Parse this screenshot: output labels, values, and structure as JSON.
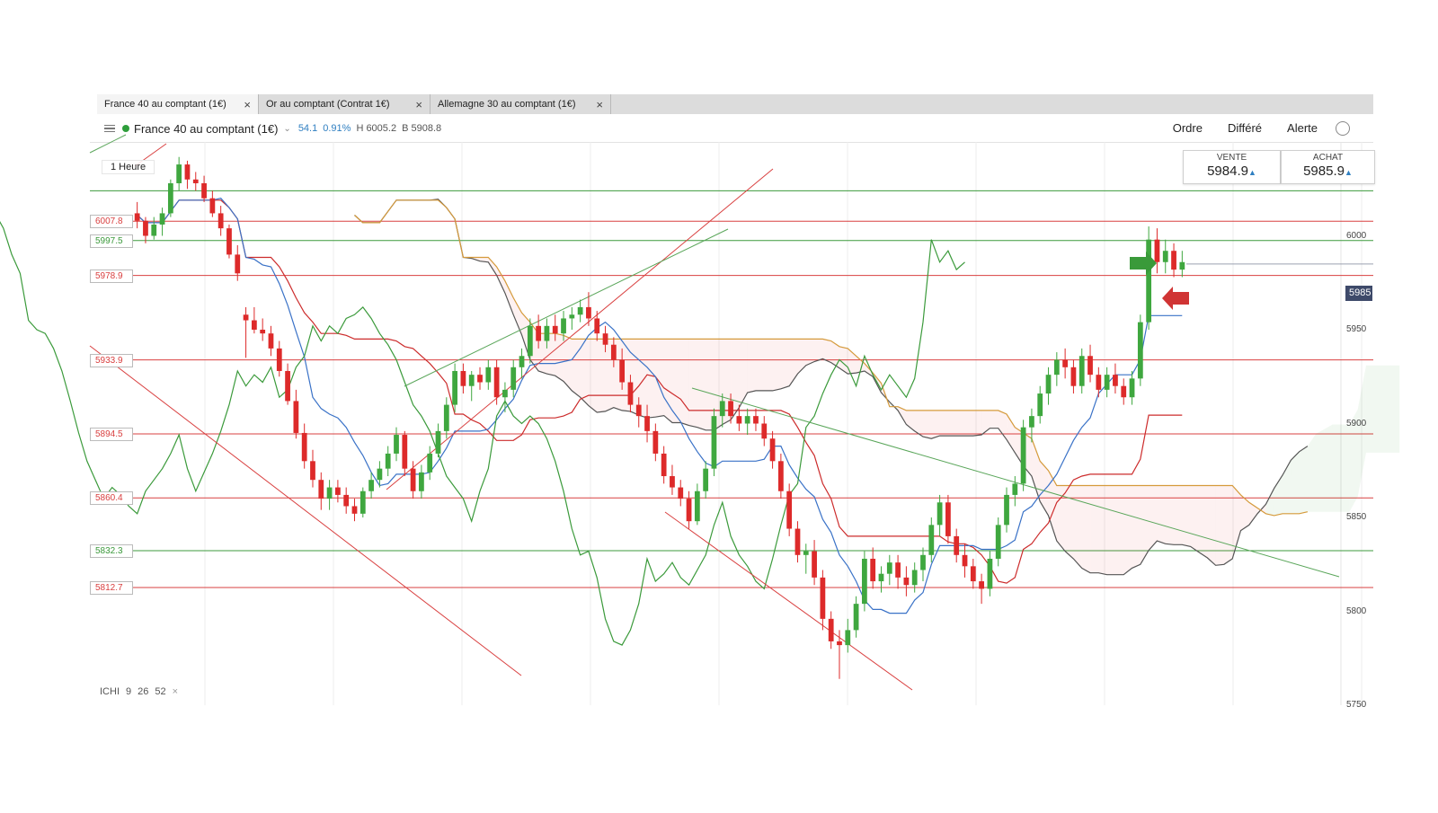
{
  "tabs": [
    {
      "label": "France 40 au comptant (1€)",
      "close": "×"
    },
    {
      "label": "Or au comptant (Contrat 1€)",
      "close": "×"
    },
    {
      "label": "Allemagne 30 au comptant (1€)",
      "close": "×"
    }
  ],
  "toolbar": {
    "menu_icon": "hamburger-icon",
    "instrument": "France 40 au comptant (1€)",
    "dropdown_icon": "chevron-down-icon",
    "change": "54.1",
    "change_pct": "0.91%",
    "high": "H 6005.2",
    "low": "B 5908.8",
    "buttons": [
      "Ordre",
      "Différé",
      "Alerte"
    ]
  },
  "timeframe": "1 Heure",
  "quote": {
    "sell_label": "VENTE",
    "sell_price": "5984.9",
    "sell_arrow": "▲",
    "buy_label": "ACHAT",
    "buy_price": "5985.9",
    "buy_arrow": "▲"
  },
  "indicator": {
    "name": "ICHI",
    "p1": "9",
    "p2": "26",
    "p3": "52",
    "remove": "×"
  },
  "levels": [
    {
      "label": "6007.8",
      "value": 6007.8,
      "color": "#d94040"
    },
    {
      "label": "5997.5",
      "value": 5997.5,
      "color": "#3c9a3c"
    },
    {
      "label": "5978.9",
      "value": 5978.9,
      "color": "#d94040"
    },
    {
      "label": "5933.9",
      "value": 5933.9,
      "color": "#d94040"
    },
    {
      "label": "5894.5",
      "value": 5894.5,
      "color": "#d94040"
    },
    {
      "label": "5860.4",
      "value": 5860.4,
      "color": "#d94040"
    },
    {
      "label": "5832.3",
      "value": 5832.3,
      "color": "#3c9a3c"
    },
    {
      "label": "5812.7",
      "value": 5812.7,
      "color": "#d94040"
    }
  ],
  "axis_labels": [
    "6000",
    "5950",
    "5900",
    "5850",
    "5800",
    "5750"
  ],
  "current_price_tag": "5985",
  "colors": {
    "bull": "#3fa73f",
    "bear": "#dd2a2a",
    "tenkan": "#3a72c7",
    "kijun": "#cc2b2b",
    "spanA": "#555555",
    "spanB": "#d59a3b",
    "chikou": "#3b9a3b"
  },
  "chart_data": {
    "type": "candlestick",
    "ylim": [
      5750,
      6050
    ],
    "y_ticks": [
      5750,
      5800,
      5850,
      5900,
      5950,
      6000
    ],
    "ohlc": [
      [
        6012,
        6018,
        6004,
        6008
      ],
      [
        6008,
        6010,
        5996,
        6000
      ],
      [
        6000,
        6010,
        5998,
        6006
      ],
      [
        6006,
        6015,
        6000,
        6012
      ],
      [
        6012,
        6030,
        6010,
        6028
      ],
      [
        6028,
        6042,
        6024,
        6038
      ],
      [
        6038,
        6040,
        6025,
        6030
      ],
      [
        6030,
        6034,
        6024,
        6028
      ],
      [
        6028,
        6032,
        6018,
        6020
      ],
      [
        6020,
        6024,
        6010,
        6012
      ],
      [
        6012,
        6016,
        6000,
        6004
      ],
      [
        6004,
        6006,
        5988,
        5990
      ],
      [
        5990,
        5995,
        5976,
        5980
      ],
      [
        5958,
        5962,
        5935,
        5955
      ],
      [
        5955,
        5962,
        5948,
        5950
      ],
      [
        5950,
        5956,
        5944,
        5948
      ],
      [
        5948,
        5952,
        5936,
        5940
      ],
      [
        5940,
        5944,
        5925,
        5928
      ],
      [
        5928,
        5932,
        5910,
        5912
      ],
      [
        5912,
        5918,
        5892,
        5895
      ],
      [
        5895,
        5900,
        5876,
        5880
      ],
      [
        5880,
        5886,
        5866,
        5870
      ],
      [
        5870,
        5874,
        5854,
        5860
      ],
      [
        5860,
        5870,
        5854,
        5866
      ],
      [
        5866,
        5870,
        5858,
        5862
      ],
      [
        5862,
        5866,
        5852,
        5856
      ],
      [
        5856,
        5860,
        5848,
        5852
      ],
      [
        5852,
        5866,
        5850,
        5864
      ],
      [
        5864,
        5874,
        5860,
        5870
      ],
      [
        5870,
        5880,
        5866,
        5876
      ],
      [
        5876,
        5888,
        5872,
        5884
      ],
      [
        5884,
        5898,
        5880,
        5894
      ],
      [
        5894,
        5896,
        5872,
        5876
      ],
      [
        5876,
        5880,
        5860,
        5864
      ],
      [
        5864,
        5878,
        5860,
        5874
      ],
      [
        5874,
        5888,
        5870,
        5884
      ],
      [
        5884,
        5900,
        5882,
        5896
      ],
      [
        5896,
        5914,
        5892,
        5910
      ],
      [
        5910,
        5932,
        5906,
        5928
      ],
      [
        5928,
        5932,
        5916,
        5920
      ],
      [
        5920,
        5928,
        5912,
        5926
      ],
      [
        5926,
        5930,
        5918,
        5922
      ],
      [
        5922,
        5934,
        5918,
        5930
      ],
      [
        5930,
        5934,
        5910,
        5914
      ],
      [
        5914,
        5922,
        5906,
        5918
      ],
      [
        5918,
        5934,
        5914,
        5930
      ],
      [
        5930,
        5940,
        5924,
        5936
      ],
      [
        5936,
        5956,
        5932,
        5952
      ],
      [
        5952,
        5958,
        5940,
        5944
      ],
      [
        5944,
        5956,
        5940,
        5952
      ],
      [
        5952,
        5958,
        5944,
        5948
      ],
      [
        5948,
        5960,
        5944,
        5956
      ],
      [
        5956,
        5962,
        5950,
        5958
      ],
      [
        5958,
        5966,
        5954,
        5962
      ],
      [
        5962,
        5970,
        5952,
        5956
      ],
      [
        5956,
        5960,
        5944,
        5948
      ],
      [
        5948,
        5952,
        5938,
        5942
      ],
      [
        5942,
        5946,
        5930,
        5934
      ],
      [
        5934,
        5940,
        5918,
        5922
      ],
      [
        5922,
        5926,
        5906,
        5910
      ],
      [
        5910,
        5914,
        5898,
        5904
      ],
      [
        5904,
        5910,
        5890,
        5896
      ],
      [
        5896,
        5900,
        5880,
        5884
      ],
      [
        5884,
        5888,
        5868,
        5872
      ],
      [
        5872,
        5878,
        5862,
        5866
      ],
      [
        5866,
        5870,
        5856,
        5860
      ],
      [
        5860,
        5864,
        5844,
        5848
      ],
      [
        5848,
        5868,
        5846,
        5864
      ],
      [
        5864,
        5880,
        5860,
        5876
      ],
      [
        5876,
        5908,
        5872,
        5904
      ],
      [
        5904,
        5916,
        5898,
        5912
      ],
      [
        5912,
        5916,
        5900,
        5904
      ],
      [
        5904,
        5910,
        5896,
        5900
      ],
      [
        5900,
        5908,
        5894,
        5904
      ],
      [
        5904,
        5908,
        5896,
        5900
      ],
      [
        5900,
        5904,
        5888,
        5892
      ],
      [
        5892,
        5896,
        5876,
        5880
      ],
      [
        5880,
        5884,
        5860,
        5864
      ],
      [
        5864,
        5868,
        5840,
        5844
      ],
      [
        5844,
        5848,
        5826,
        5830
      ],
      [
        5830,
        5836,
        5820,
        5832
      ],
      [
        5832,
        5838,
        5814,
        5818
      ],
      [
        5818,
        5822,
        5790,
        5796
      ],
      [
        5796,
        5800,
        5780,
        5784
      ],
      [
        5784,
        5790,
        5764,
        5782
      ],
      [
        5782,
        5796,
        5778,
        5790
      ],
      [
        5790,
        5808,
        5786,
        5804
      ],
      [
        5804,
        5832,
        5800,
        5828
      ],
      [
        5828,
        5834,
        5812,
        5816
      ],
      [
        5816,
        5824,
        5810,
        5820
      ],
      [
        5820,
        5830,
        5814,
        5826
      ],
      [
        5826,
        5830,
        5812,
        5818
      ],
      [
        5818,
        5824,
        5808,
        5814
      ],
      [
        5814,
        5826,
        5810,
        5822
      ],
      [
        5822,
        5834,
        5816,
        5830
      ],
      [
        5830,
        5850,
        5826,
        5846
      ],
      [
        5846,
        5862,
        5840,
        5858
      ],
      [
        5858,
        5862,
        5836,
        5840
      ],
      [
        5840,
        5844,
        5826,
        5830
      ],
      [
        5830,
        5836,
        5818,
        5824
      ],
      [
        5824,
        5828,
        5812,
        5816
      ],
      [
        5816,
        5820,
        5804,
        5812
      ],
      [
        5812,
        5832,
        5808,
        5828
      ],
      [
        5828,
        5850,
        5824,
        5846
      ],
      [
        5846,
        5866,
        5842,
        5862
      ],
      [
        5862,
        5872,
        5856,
        5868
      ],
      [
        5868,
        5902,
        5864,
        5898
      ],
      [
        5898,
        5908,
        5890,
        5904
      ],
      [
        5904,
        5920,
        5900,
        5916
      ],
      [
        5916,
        5930,
        5910,
        5926
      ],
      [
        5926,
        5938,
        5920,
        5934
      ],
      [
        5934,
        5940,
        5924,
        5930
      ],
      [
        5930,
        5934,
        5916,
        5920
      ],
      [
        5920,
        5940,
        5916,
        5936
      ],
      [
        5936,
        5942,
        5922,
        5926
      ],
      [
        5926,
        5930,
        5914,
        5918
      ],
      [
        5918,
        5930,
        5914,
        5926
      ],
      [
        5926,
        5932,
        5916,
        5920
      ],
      [
        5920,
        5924,
        5910,
        5914
      ],
      [
        5914,
        5928,
        5910,
        5924
      ],
      [
        5924,
        5958,
        5920,
        5954
      ],
      [
        5954,
        6005,
        5950,
        5998
      ],
      [
        5998,
        6004,
        5980,
        5986
      ],
      [
        5986,
        5998,
        5980,
        5992
      ],
      [
        5992,
        5996,
        5978,
        5982
      ],
      [
        5982,
        5992,
        5978,
        5986
      ]
    ]
  }
}
